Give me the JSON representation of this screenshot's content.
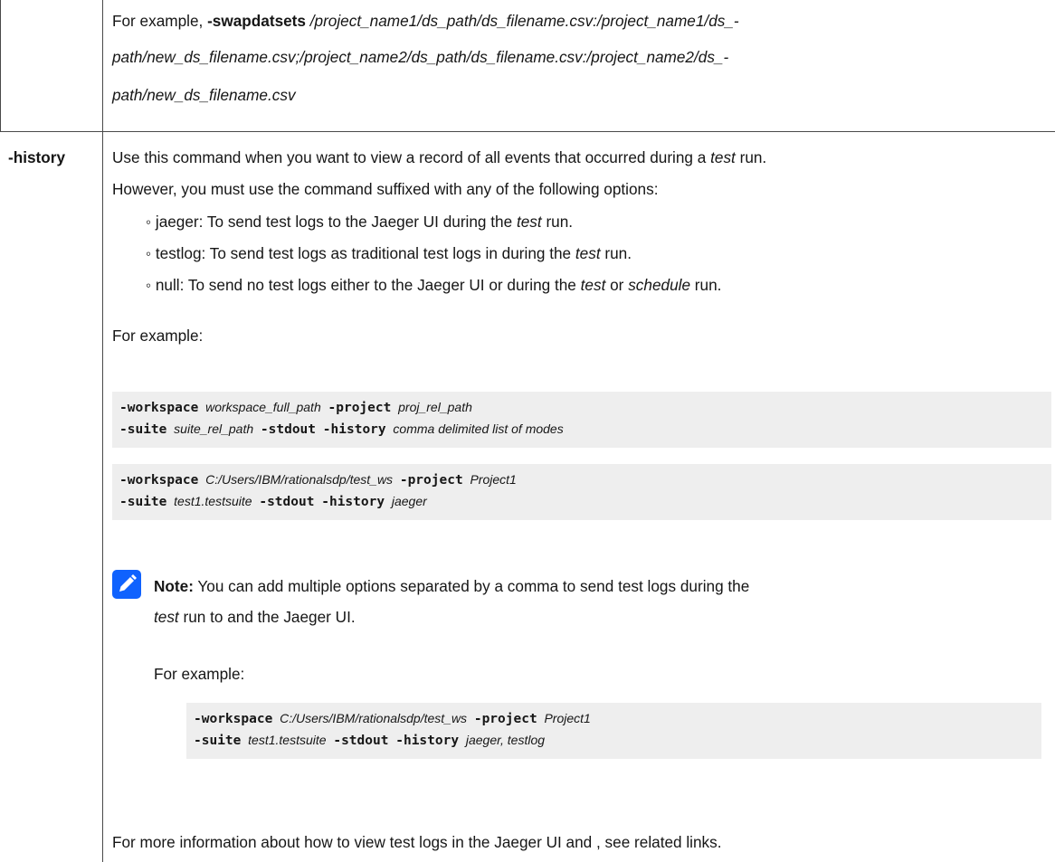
{
  "top_row": {
    "prefix": "For example,",
    "flag": "-swapdatsets",
    "path_line1": "/project_name1/ds_path/ds_filename.csv:/project_name1/ds_-",
    "path_line2": "path/new_ds_filename.csv;/project_name2/ds_path/ds_filename.csv:/project_name2/ds_-",
    "path_line3": "path/new_ds_filename.csv"
  },
  "history_row": {
    "option": "-history",
    "intro_a": "Use this command when you want to view a record of all events that occurred during a",
    "intro_test": "test",
    "intro_b": "run.",
    "intro_line2": "However, you must use the command suffixed with any of the following options:",
    "bullets": [
      {
        "a": "jaeger: To send test logs to the Jaeger UI during the",
        "i": "test",
        "b": "run."
      },
      {
        "a": "testlog: To send test logs as traditional test logs in during the",
        "i": "test",
        "b": "run."
      },
      {
        "a": "null: To send no test logs either to the Jaeger UI or during the",
        "i": "test",
        "mid": "or",
        "i2": "schedule",
        "b": "run."
      }
    ],
    "for_example": "For example:",
    "code1": {
      "workspace": "-workspace",
      "workspace_val": "workspace_full_path",
      "project": "-project",
      "project_val": "proj_rel_path",
      "suite": "-suite",
      "suite_val": "suite_rel_path",
      "stdout": "-stdout",
      "history": "-history",
      "history_val": "comma delimited list of modes"
    },
    "code2": {
      "workspace": "-workspace",
      "workspace_val": "C:/Users/IBM/rationalsdp/test_ws",
      "project": "-project",
      "project_val": "Project1",
      "suite": "-suite",
      "suite_val": "test1.testsuite",
      "stdout": "-stdout",
      "history": "-history",
      "history_val": "jaeger"
    },
    "note": {
      "icon": "pencil-icon",
      "label": "Note:",
      "text_line1": "You can add multiple options separated by a comma to send test logs during the",
      "text_test": "test",
      "text_line2": "run to and the Jaeger UI.",
      "for_example": "For example:",
      "code": {
        "workspace": "-workspace",
        "workspace_val": "C:/Users/IBM/rationalsdp/test_ws",
        "project": "-project",
        "project_val": "Project1",
        "suite": "-suite",
        "suite_val": "test1.testsuite",
        "stdout": "-stdout",
        "history": "-history",
        "history_val": "jaeger, testlog"
      }
    },
    "more_info": "For more information about how to view test logs in the Jaeger UI and , see related links."
  },
  "colors": {
    "note_icon": "#0f62fe",
    "code_bg": "#eeeeee",
    "border": "#4a4a4a"
  }
}
